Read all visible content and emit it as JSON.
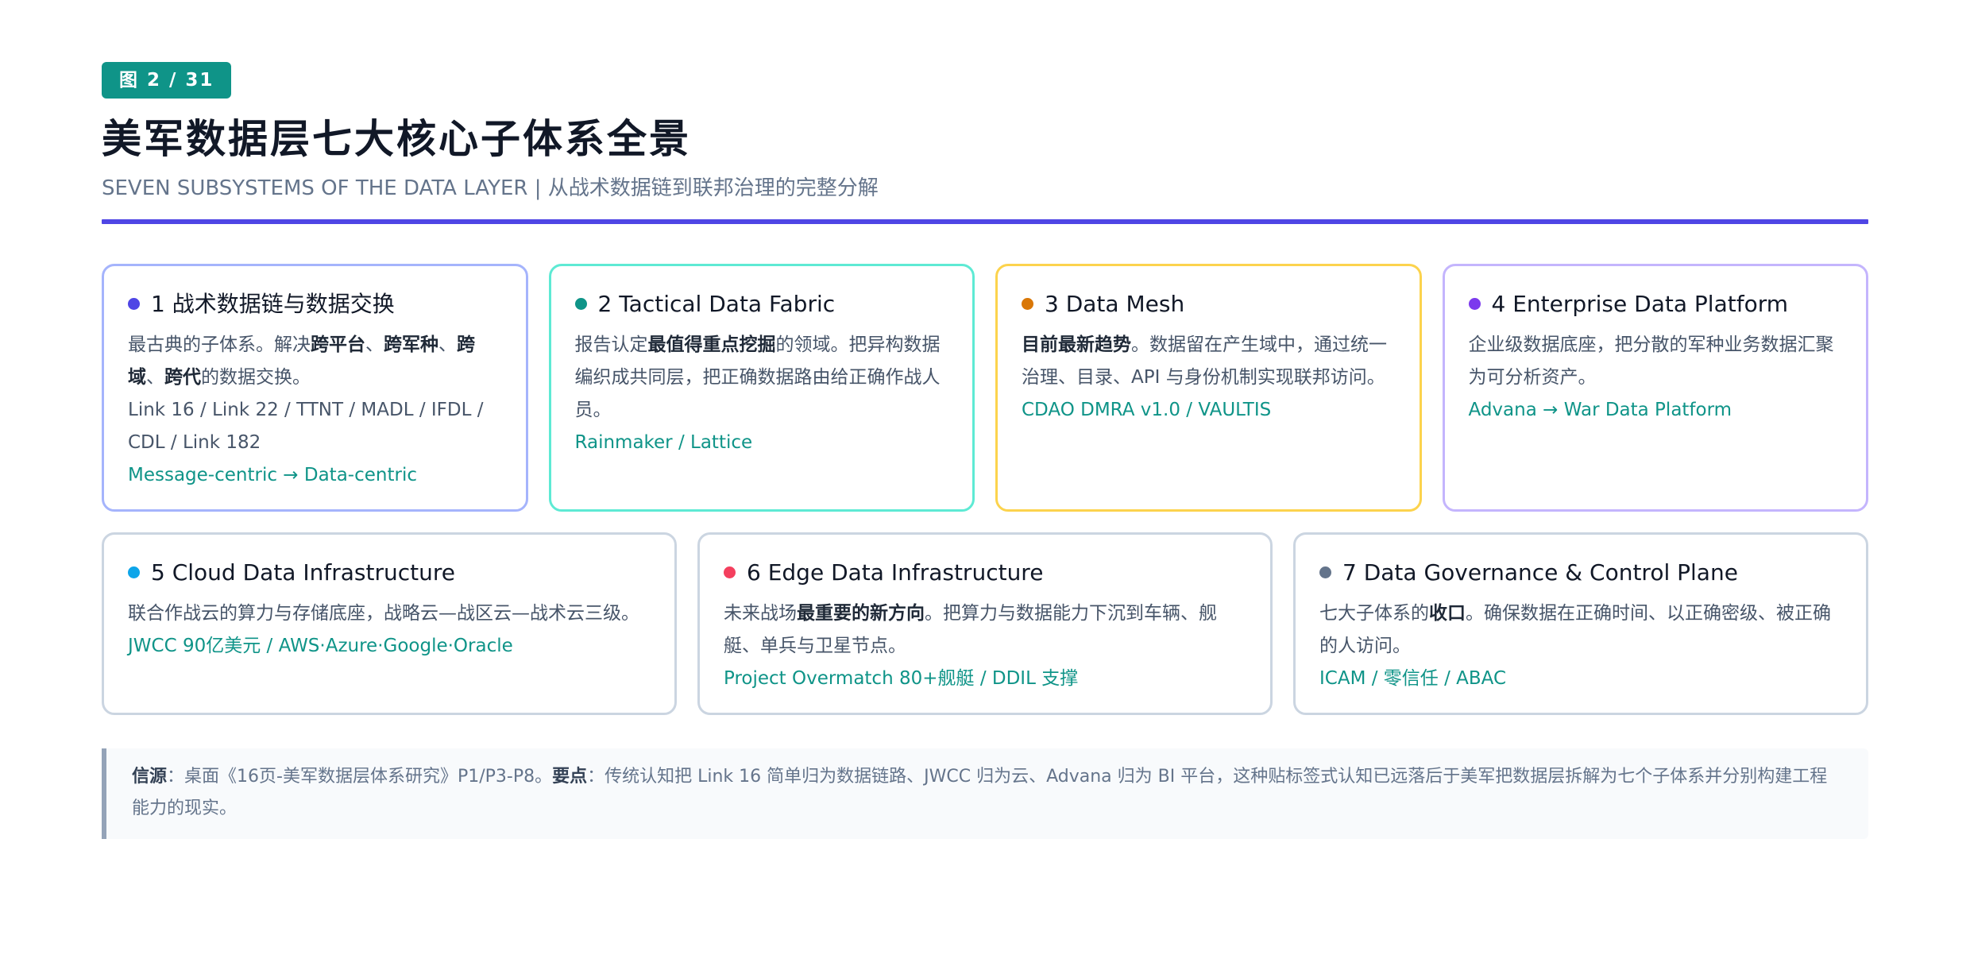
{
  "header": {
    "badge": "图 2 / 31",
    "title": "美军数据层七大核心子体系全景",
    "subtitle": "SEVEN SUBSYSTEMS OF THE DATA LAYER | 从战术数据链到联邦治理的完整分解"
  },
  "colors": {
    "accent_rule": "#4f46e5",
    "badge_bg": "#0f9488",
    "accent_text": "#0f9488"
  },
  "cards": [
    {
      "title": "1 战术数据链与数据交换",
      "dot_color": "#4f46e5",
      "border_color": "#a5b4fc",
      "body": [
        {
          "t": "最古典的子体系。解决"
        },
        {
          "t": "跨平台",
          "b": true
        },
        {
          "t": "、"
        },
        {
          "t": "跨军种",
          "b": true
        },
        {
          "t": "、"
        },
        {
          "t": "跨域",
          "b": true
        },
        {
          "t": "、"
        },
        {
          "t": "跨代",
          "b": true
        },
        {
          "t": "的数据交换。"
        }
      ],
      "tags": "Link 16 / Link 22 / TTNT / MADL / IFDL / CDL / Link 182",
      "accent": "Message-centric → Data-centric"
    },
    {
      "title": "2 Tactical Data Fabric",
      "dot_color": "#0f9488",
      "border_color": "#5eead4",
      "body": [
        {
          "t": "报告认定"
        },
        {
          "t": "最值得重点挖掘",
          "b": true
        },
        {
          "t": "的领域。把异构数据编织成共同层，把正确数据路由给正确作战人员。"
        }
      ],
      "tags": "",
      "accent": "Rainmaker / Lattice"
    },
    {
      "title": "3 Data Mesh",
      "dot_color": "#d97706",
      "border_color": "#fcd34d",
      "body": [
        {
          "t": "目前最新趋势",
          "b": true
        },
        {
          "t": "。数据留在产生域中，通过统一治理、目录、API 与身份机制实现联邦访问。"
        }
      ],
      "tags": "",
      "accent": "CDAO DMRA v1.0 / VAULTIS"
    },
    {
      "title": "4 Enterprise Data Platform",
      "dot_color": "#7c3aed",
      "border_color": "#c4b5fd",
      "body": [
        {
          "t": "企业级数据底座，把分散的军种业务数据汇聚为可分析资产。"
        }
      ],
      "tags": "",
      "accent": "Advana → War Data Platform"
    },
    {
      "title": "5 Cloud Data Infrastructure",
      "dot_color": "#0ea5e9",
      "border_color": "#cbd5e1",
      "body": [
        {
          "t": "联合作战云的算力与存储底座，战略云—战区云—战术云三级。"
        }
      ],
      "tags": "",
      "accent": "JWCC 90亿美元 / AWS·Azure·Google·Oracle"
    },
    {
      "title": "6 Edge Data Infrastructure",
      "dot_color": "#f43f5e",
      "border_color": "#cbd5e1",
      "body": [
        {
          "t": "未来战场"
        },
        {
          "t": "最重要的新方向",
          "b": true
        },
        {
          "t": "。把算力与数据能力下沉到车辆、舰艇、单兵与卫星节点。"
        }
      ],
      "tags": "",
      "accent": "Project Overmatch 80+舰艇 / DDIL 支撑"
    },
    {
      "title": "7 Data Governance & Control Plane",
      "dot_color": "#64748b",
      "border_color": "#cbd5e1",
      "body": [
        {
          "t": "七大子体系的"
        },
        {
          "t": "收口",
          "b": true
        },
        {
          "t": "。确保数据在正确时间、以正确密级、被正确的人访问。"
        }
      ],
      "tags": "",
      "accent": "ICAM / 零信任 / ABAC"
    }
  ],
  "note": {
    "source_label": "信源",
    "source_text": "：桌面《16页-美军数据层体系研究》P1/P3-P8。",
    "key_label": "要点",
    "key_text": "：传统认知把 Link 16 简单归为数据链路、JWCC 归为云、Advana 归为 BI 平台，这种贴标签式认知已远落后于美军把数据层拆解为七个子体系并分别构建工程能力的现实。"
  }
}
